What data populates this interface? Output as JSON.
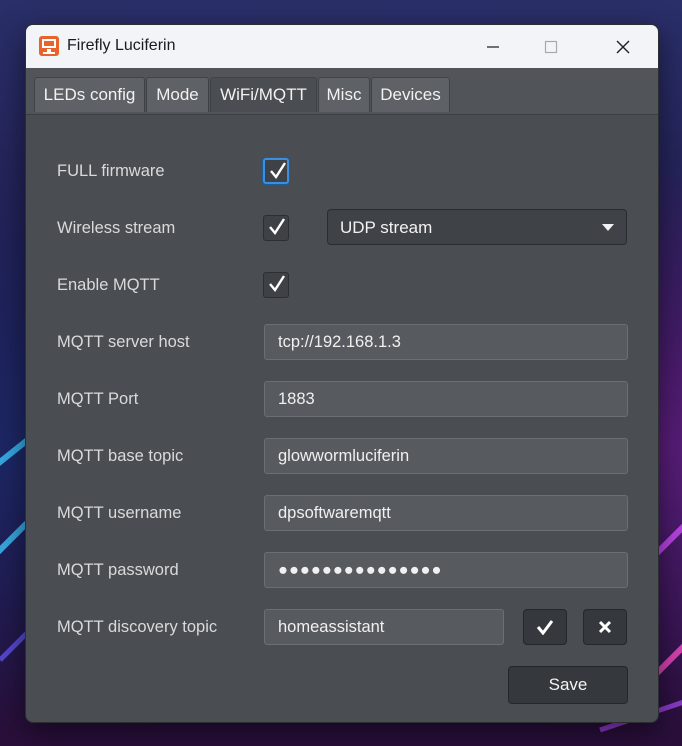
{
  "window": {
    "title": "Firefly Luciferin",
    "minimize_icon": "minimize-icon",
    "maximize_icon": "maximize-icon",
    "close_icon": "close-icon"
  },
  "tabs": [
    {
      "label": "LEDs config",
      "active": false
    },
    {
      "label": "Mode",
      "active": false
    },
    {
      "label": "WiFi/MQTT",
      "active": true
    },
    {
      "label": "Misc",
      "active": false
    },
    {
      "label": "Devices",
      "active": false
    }
  ],
  "form": {
    "full_firmware": {
      "label": "FULL firmware",
      "checked": true
    },
    "wireless_stream": {
      "label": "Wireless stream",
      "checked": true,
      "selected": "UDP stream"
    },
    "enable_mqtt": {
      "label": "Enable MQTT",
      "checked": true
    },
    "mqtt_server_host": {
      "label": "MQTT server host",
      "value": "tcp://192.168.1.3"
    },
    "mqtt_port": {
      "label": "MQTT Port",
      "value": "1883"
    },
    "mqtt_base_topic": {
      "label": "MQTT base topic",
      "value": "glowwormluciferin"
    },
    "mqtt_username": {
      "label": "MQTT username",
      "value": "dpsoftwaremqtt"
    },
    "mqtt_password": {
      "label": "MQTT password",
      "value": "●●●●●●●●●●●●●●●"
    },
    "mqtt_discovery_topic": {
      "label": "MQTT discovery topic",
      "value": "homeassistant"
    }
  },
  "buttons": {
    "discovery_confirm_icon": "checkmark-icon",
    "discovery_delete_icon": "cross-icon",
    "save_label": "Save"
  },
  "colors": {
    "accent": "#e8622c",
    "focus": "#3a8fe0",
    "window_bg": "#4a4d51"
  }
}
